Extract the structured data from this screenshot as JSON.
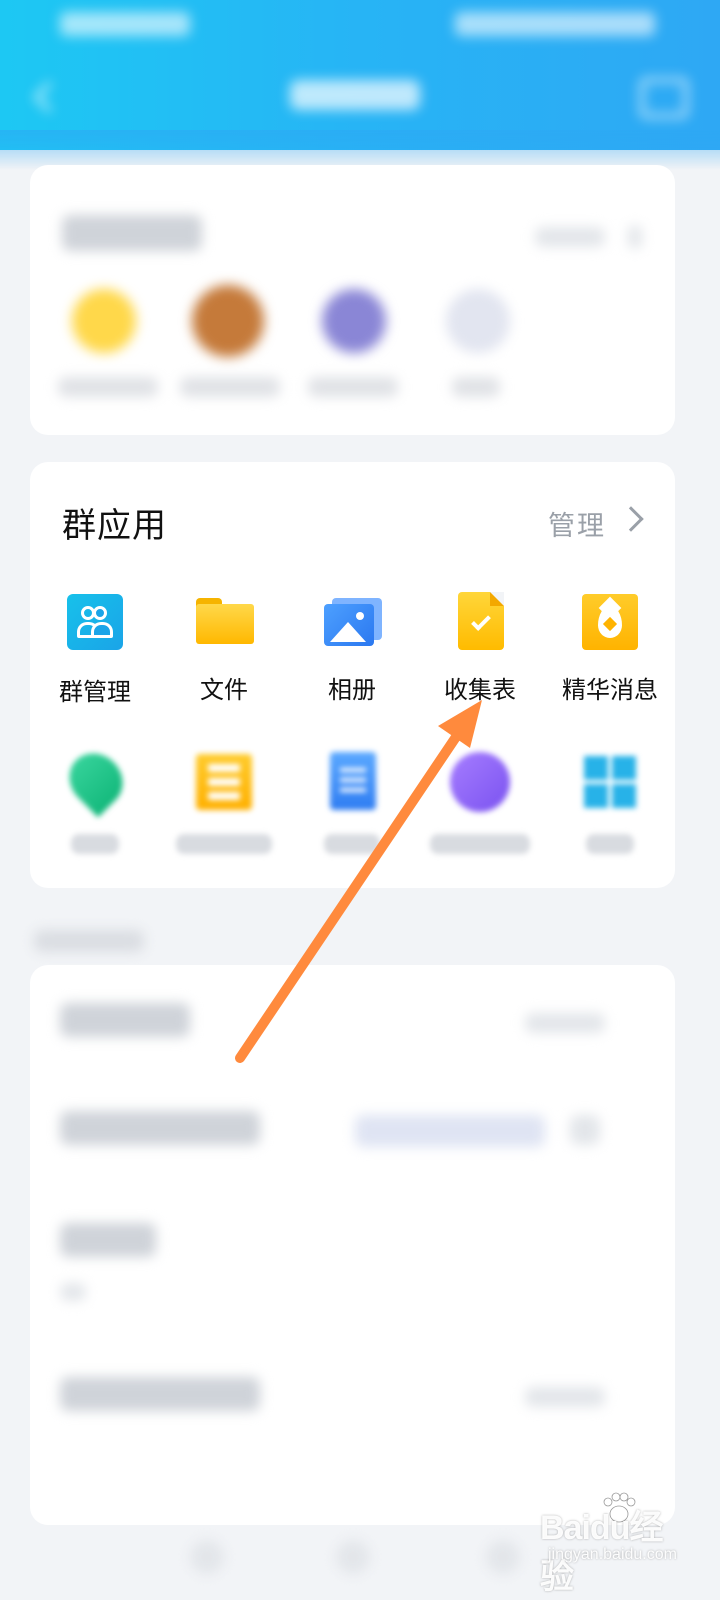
{
  "group_apps": {
    "title": "群应用",
    "manage_label": "管理",
    "row1": [
      {
        "label": "群管理",
        "icon": "group-management-icon"
      },
      {
        "label": "文件",
        "icon": "folder-icon"
      },
      {
        "label": "相册",
        "icon": "album-icon"
      },
      {
        "label": "收集表",
        "icon": "collection-form-icon"
      },
      {
        "label": "精华消息",
        "icon": "essence-message-icon"
      }
    ],
    "row2_icons": [
      "check-in-icon",
      "list-icon",
      "document-icon",
      "earphones-icon",
      "grid-icon"
    ]
  },
  "annotation": {
    "type": "arrow",
    "color": "#ff8a3d",
    "points_to": "收集表"
  },
  "watermark": {
    "logo": "Baidu经验",
    "sub": "jingyan.baidu.com"
  },
  "colors": {
    "header_gradient_start": "#1dc8f3",
    "header_gradient_end": "#2ea8f4",
    "page_background": "#f2f4f7",
    "card_background": "#ffffff",
    "manage_text": "#9aa0a8"
  }
}
